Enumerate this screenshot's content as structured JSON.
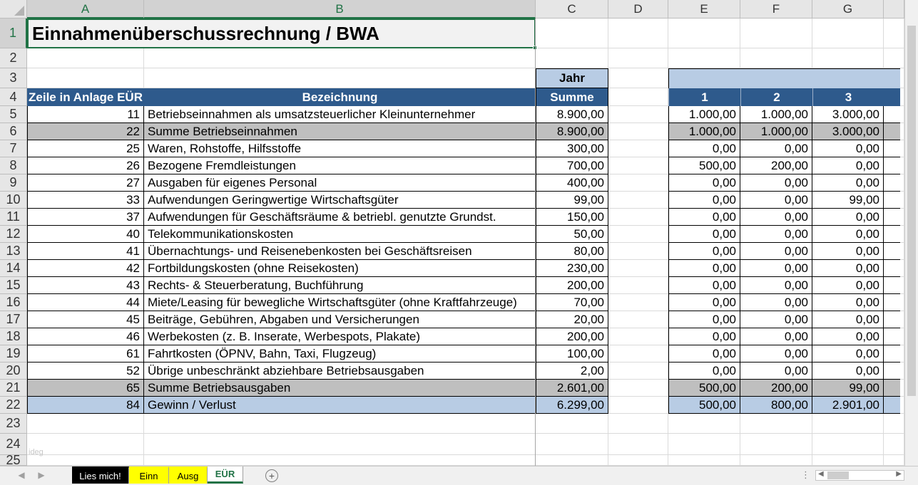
{
  "sheet": {
    "columns": [
      "A",
      "B",
      "C",
      "D",
      "E",
      "F",
      "G"
    ],
    "rows": [
      "1",
      "2",
      "3",
      "4",
      "5",
      "6",
      "7",
      "8",
      "9",
      "10",
      "11",
      "12",
      "13",
      "14",
      "15",
      "16",
      "17",
      "18",
      "19",
      "20",
      "21",
      "22",
      "23",
      "24",
      "25"
    ],
    "title": "Einnahmenüberschussrechnung / BWA",
    "year_label": "Jahr",
    "header": {
      "zeile": "Zeile in Anlage EÜR",
      "bezeichnung": "Bezeichnung",
      "summe": "Summe",
      "months": [
        "1",
        "2",
        "3"
      ]
    },
    "data_rows": [
      {
        "zeile": "11",
        "label": "Betriebseinnahmen als umsatzsteuerlicher Kleinunternehmer",
        "summe": "8.900,00",
        "m": [
          "1.000,00",
          "1.000,00",
          "3.000,00"
        ],
        "style": "normal"
      },
      {
        "zeile": "22",
        "label": "Summe Betriebseinnahmen",
        "summe": "8.900,00",
        "m": [
          "1.000,00",
          "1.000,00",
          "3.000,00"
        ],
        "style": "grey"
      },
      {
        "zeile": "25",
        "label": "Waren, Rohstoffe, Hilfsstoffe",
        "summe": "300,00",
        "m": [
          "0,00",
          "0,00",
          "0,00"
        ],
        "style": "normal"
      },
      {
        "zeile": "26",
        "label": "Bezogene Fremdleistungen",
        "summe": "700,00",
        "m": [
          "500,00",
          "200,00",
          "0,00"
        ],
        "style": "normal"
      },
      {
        "zeile": "27",
        "label": "Ausgaben für eigenes Personal",
        "summe": "400,00",
        "m": [
          "0,00",
          "0,00",
          "0,00"
        ],
        "style": "normal"
      },
      {
        "zeile": "33",
        "label": "Aufwendungen Geringwertige Wirtschaftsgüter",
        "summe": "99,00",
        "m": [
          "0,00",
          "0,00",
          "99,00"
        ],
        "style": "normal"
      },
      {
        "zeile": "37",
        "label": "Aufwendungen für Geschäftsräume & betriebl. genutzte Grundst.",
        "summe": "150,00",
        "m": [
          "0,00",
          "0,00",
          "0,00"
        ],
        "style": "normal"
      },
      {
        "zeile": "40",
        "label": "Telekommunikationskosten",
        "summe": "50,00",
        "m": [
          "0,00",
          "0,00",
          "0,00"
        ],
        "style": "normal"
      },
      {
        "zeile": "41",
        "label": "Übernachtungs- und Reisenebenkosten bei Geschäftsreisen",
        "summe": "80,00",
        "m": [
          "0,00",
          "0,00",
          "0,00"
        ],
        "style": "normal"
      },
      {
        "zeile": "42",
        "label": "Fortbildungskosten (ohne Reisekosten)",
        "summe": "230,00",
        "m": [
          "0,00",
          "0,00",
          "0,00"
        ],
        "style": "normal"
      },
      {
        "zeile": "43",
        "label": "Rechts- & Steuerberatung, Buchführung",
        "summe": "200,00",
        "m": [
          "0,00",
          "0,00",
          "0,00"
        ],
        "style": "normal"
      },
      {
        "zeile": "44",
        "label": "Miete/Leasing für bewegliche Wirtschaftsgüter (ohne Kraftfahrzeuge)",
        "summe": "70,00",
        "m": [
          "0,00",
          "0,00",
          "0,00"
        ],
        "style": "normal"
      },
      {
        "zeile": "45",
        "label": "Beiträge, Gebühren, Abgaben und Versicherungen",
        "summe": "20,00",
        "m": [
          "0,00",
          "0,00",
          "0,00"
        ],
        "style": "normal"
      },
      {
        "zeile": "46",
        "label": "Werbekosten (z. B. Inserate, Werbespots, Plakate)",
        "summe": "200,00",
        "m": [
          "0,00",
          "0,00",
          "0,00"
        ],
        "style": "normal"
      },
      {
        "zeile": "61",
        "label": "Fahrtkosten (ÖPNV, Bahn, Taxi, Flugzeug)",
        "summe": "100,00",
        "m": [
          "0,00",
          "0,00",
          "0,00"
        ],
        "style": "normal"
      },
      {
        "zeile": "52",
        "label": "Übrige unbeschränkt abziehbare Betriebsausgaben",
        "summe": "2,00",
        "m": [
          "0,00",
          "0,00",
          "0,00"
        ],
        "style": "normal"
      },
      {
        "zeile": "65",
        "label": "Summe Betriebsausgaben",
        "summe": "2.601,00",
        "m": [
          "500,00",
          "200,00",
          "99,00"
        ],
        "style": "grey"
      },
      {
        "zeile": "84",
        "label": "Gewinn / Verlust",
        "summe": "6.299,00",
        "m": [
          "500,00",
          "800,00",
          "2.901,00"
        ],
        "style": "blue"
      }
    ],
    "watermark": "ideg"
  },
  "tabs": [
    {
      "label": "Lies mich!",
      "bg": "#000000",
      "fg": "#ffffff",
      "active": false
    },
    {
      "label": "Einn",
      "bg": "#ffff00",
      "fg": "#000000",
      "active": false
    },
    {
      "label": "Ausg",
      "bg": "#ffff00",
      "fg": "#000000",
      "active": false
    },
    {
      "label": "EÜR",
      "bg": "#ffffff",
      "fg": "#217346",
      "active": true
    }
  ],
  "colors": {
    "header_blue": "#2e5a8c",
    "light_blue": "#b8cce4",
    "grey": "#bfbfbf",
    "excel_green": "#217346"
  }
}
